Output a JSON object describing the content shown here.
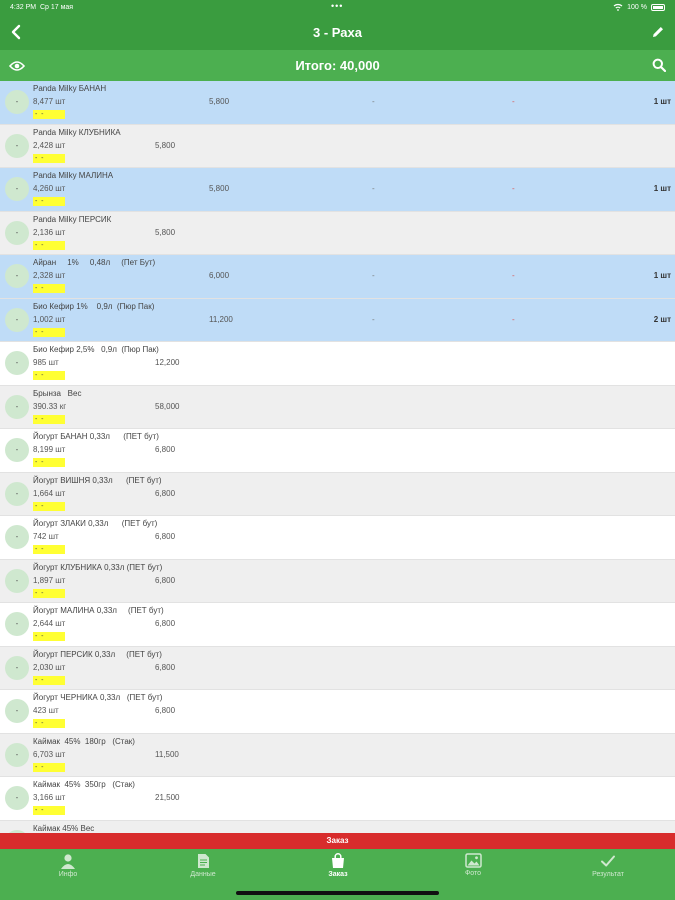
{
  "status": {
    "time": "4:32 PM",
    "date": "Ср 17 мая",
    "dots": "•••",
    "battery": "100 %"
  },
  "header": {
    "title": "3 - Раха"
  },
  "total": {
    "label": "Итого: 40,000"
  },
  "items": [
    {
      "name": "Panda Milky БАНАН",
      "stock": "8,477 шт",
      "price": "5,800",
      "state": "sel",
      "circle": "-",
      "strip": " -  -",
      "dash1": "-",
      "dash2": "-",
      "qty": "1 шт"
    },
    {
      "name": "Panda Milky КЛУБНИКА",
      "stock": "2,428 шт",
      "price": "5,800",
      "state": "alt",
      "circle": "-",
      "strip": " -  -"
    },
    {
      "name": "Panda Milky МАЛИНА",
      "stock": "4,260 шт",
      "price": "5,800",
      "state": "sel",
      "circle": "-",
      "strip": " -  -",
      "dash1": "-",
      "dash2": "-",
      "qty": "1 шт"
    },
    {
      "name": "Panda Milky ПЕРСИК",
      "stock": "2,136 шт",
      "price": "5,800",
      "state": "alt",
      "circle": "-",
      "strip": " -  -"
    },
    {
      "name": "Айран     1%     0,48л     (Пет Бут)",
      "stock": "2,328 шт",
      "price": "6,000",
      "state": "sel",
      "circle": "-",
      "strip": " -  -",
      "dash1": "-",
      "dash2": "-",
      "qty": "1 шт"
    },
    {
      "name": "Био Кефир 1%    0,9л  (Пюр Пак)",
      "stock": "1,002 шт",
      "price": "11,200",
      "state": "sel",
      "circle": "-",
      "strip": " -  -",
      "dash1": "-",
      "dash2": "-",
      "qty": "2 шт"
    },
    {
      "name": "Био Кефир 2,5%   0,9л  (Пюр Пак)",
      "stock": "985 шт",
      "price": "12,200",
      "state": "plain",
      "circle": "-",
      "strip": " -  -"
    },
    {
      "name": "Брынза   Вес",
      "stock": "390.33 кг",
      "price": "58,000",
      "state": "alt",
      "circle": "-",
      "strip": " -  -"
    },
    {
      "name": "Йогурт БАНАН 0,33л      (ПЕТ бут)",
      "stock": "8,199 шт",
      "price": "6,800",
      "state": "plain",
      "circle": "-",
      "strip": " -  -"
    },
    {
      "name": "Йогурт ВИШНЯ 0,33л      (ПЕТ бут)",
      "stock": "1,664 шт",
      "price": "6,800",
      "state": "alt",
      "circle": "-",
      "strip": " -  -"
    },
    {
      "name": "Йогурт ЗЛАКИ 0,33л      (ПЕТ бут)",
      "stock": "742 шт",
      "price": "6,800",
      "state": "plain",
      "circle": "-",
      "strip": " -  -"
    },
    {
      "name": "Йогурт КЛУБНИКА 0,33л (ПЕТ бут)",
      "stock": "1,897 шт",
      "price": "6,800",
      "state": "alt",
      "circle": "-",
      "strip": " -  -"
    },
    {
      "name": "Йогурт МАЛИНА 0,33л     (ПЕТ бут)",
      "stock": "2,644 шт",
      "price": "6,800",
      "state": "plain",
      "circle": "-",
      "strip": " -  -"
    },
    {
      "name": "Йогурт ПЕРСИК 0,33л     (ПЕТ бут)",
      "stock": "2,030 шт",
      "price": "6,800",
      "state": "alt",
      "circle": "-",
      "strip": " -  -"
    },
    {
      "name": "Йогурт ЧЕРНИКА 0,33л   (ПЕТ бут)",
      "stock": "423 шт",
      "price": "6,800",
      "state": "plain",
      "circle": "-",
      "strip": " -  -"
    },
    {
      "name": "Каймак  45%  180гр   (Стак)",
      "stock": "6,703 шт",
      "price": "11,500",
      "state": "alt",
      "circle": "-",
      "strip": " -  -"
    },
    {
      "name": "Каймак  45%  350гр   (Стак)",
      "stock": "3,166 шт",
      "price": "21,500",
      "state": "plain",
      "circle": "-",
      "strip": " -  -"
    },
    {
      "name": "Каймак 45% Вес",
      "stock": "",
      "price": "",
      "state": "alt",
      "circle": "-",
      "strip": ""
    }
  ],
  "order_bar": {
    "label": "Заказ"
  },
  "tabs": [
    {
      "label": "Инфо",
      "icon": "person-icon"
    },
    {
      "label": "Данные",
      "icon": "document-icon"
    },
    {
      "label": "Заказ",
      "icon": "bag-icon",
      "active": true
    },
    {
      "label": "Фото",
      "icon": "image-icon"
    },
    {
      "label": "Результат",
      "icon": "checkmark-icon"
    }
  ]
}
